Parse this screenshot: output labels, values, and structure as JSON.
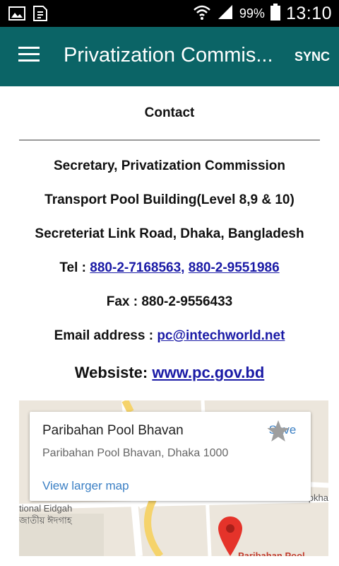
{
  "status_bar": {
    "battery": "99%",
    "time": "13:10"
  },
  "app_bar": {
    "title": "Privatization Commis...",
    "sync_label": "SYNC"
  },
  "contact": {
    "heading": "Contact",
    "lines": [
      "Secretary, Privatization Commission",
      "Transport Pool Building(Level 8,9 & 10)",
      "Secreteriat Link Road, Dhaka, Bangladesh"
    ],
    "tel_label": "Tel :",
    "tel_numbers": [
      "880-2-7168563,",
      "880-2-9551986"
    ],
    "fax": "Fax : 880-2-9556433",
    "email_label": "Email address :",
    "email": "pc@intechworld.net",
    "website_label": "Websiste:",
    "website": "www.pc.gov.bd"
  },
  "map": {
    "place_name": "Paribahan Pool Bhavan",
    "place_address": "Paribahan Pool Bhavan, Dhaka 1000",
    "save_label": "Save",
    "view_larger": "View larger map",
    "labels": {
      "eidgah_en": "tional Eidgah",
      "eidgah_bn": "জাতীয় ঈদগাহ",
      "topkhana": "Topkhan",
      "pin_place": "Paribahan Pool"
    }
  }
}
